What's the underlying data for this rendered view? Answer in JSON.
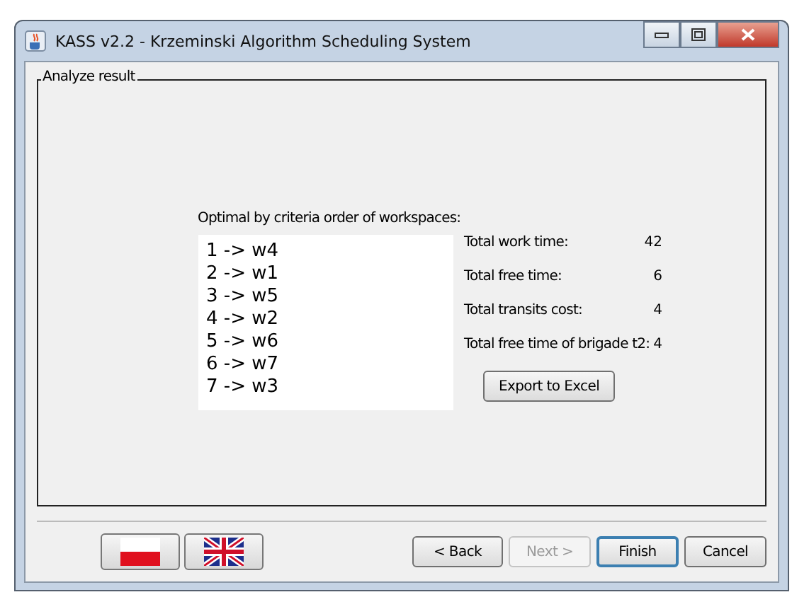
{
  "window": {
    "title": "KASS v2.2 - Krzeminski Algorithm Scheduling System"
  },
  "group": {
    "title": "Analyze result"
  },
  "order": {
    "heading": "Optimal by criteria order of workspaces:",
    "items": [
      "1 -> w4",
      "2 -> w1",
      "3 -> w5",
      "4 -> w2",
      "5 -> w6",
      "6 -> w7",
      "7 -> w3"
    ]
  },
  "stats": [
    {
      "label": "Total work time:",
      "value": "42"
    },
    {
      "label": "Total free time:",
      "value": "6"
    },
    {
      "label": "Total transits cost:",
      "value": "4"
    },
    {
      "label": "Total free time of brigade t2:",
      "value": "4"
    }
  ],
  "export_button": "Export to Excel",
  "languages": [
    {
      "kind": "polish"
    },
    {
      "kind": "english"
    }
  ],
  "nav_buttons": [
    {
      "label": "< Back",
      "disabled": false,
      "default": false
    },
    {
      "label": "Next >",
      "disabled": true,
      "default": false
    },
    {
      "label": "Finish",
      "disabled": false,
      "default": true
    },
    {
      "label": "Cancel",
      "disabled": false,
      "default": false
    }
  ]
}
